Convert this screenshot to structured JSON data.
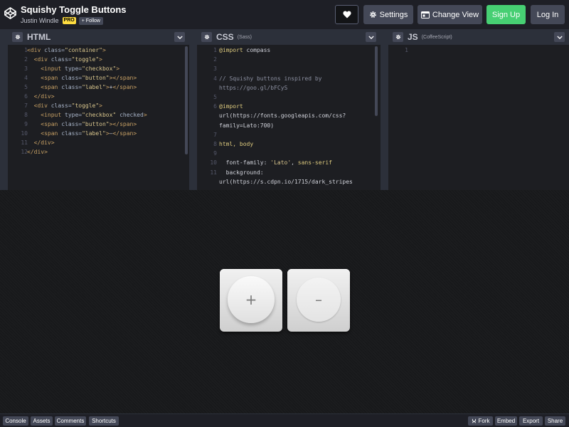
{
  "header": {
    "title": "Squishy Toggle Buttons",
    "author": "Justin Windle",
    "pro_badge": "PRO",
    "follow_label": "+ Follow",
    "settings_label": "Settings",
    "change_view_label": "Change View",
    "signup_label": "Sign Up",
    "login_label": "Log In"
  },
  "editors": {
    "html": {
      "title": "HTML",
      "lines": [
        {
          "n": "1",
          "html": "<span class=\"t\">&lt;div</span> <span class=\"a\">class=</span><span class=\"s\">\"container\"</span><span class=\"t\">&gt;</span>"
        },
        {
          "n": "2",
          "html": "  <span class=\"t\">&lt;div</span> <span class=\"a\">class=</span><span class=\"s\">\"toggle\"</span><span class=\"t\">&gt;</span>"
        },
        {
          "n": "3",
          "html": "    <span class=\"t\">&lt;input</span> <span class=\"a\">type=</span><span class=\"s\">\"checkbox\"</span><span class=\"t\">&gt;</span>"
        },
        {
          "n": "4",
          "html": "    <span class=\"t\">&lt;span</span> <span class=\"a\">class=</span><span class=\"s\">\"button\"</span><span class=\"t\">&gt;&lt;/span&gt;</span>"
        },
        {
          "n": "5",
          "html": "    <span class=\"t\">&lt;span</span> <span class=\"a\">class=</span><span class=\"s\">\"label\"</span><span class=\"t\">&gt;</span>+<span class=\"t\">&lt;/span&gt;</span>"
        },
        {
          "n": "6",
          "html": "  <span class=\"t\">&lt;/div&gt;</span>"
        },
        {
          "n": "7",
          "html": "  <span class=\"t\">&lt;div</span> <span class=\"a\">class=</span><span class=\"s\">\"toggle\"</span><span class=\"t\">&gt;</span>"
        },
        {
          "n": "8",
          "html": "    <span class=\"t\">&lt;input</span> <span class=\"a\">type=</span><span class=\"s\">\"checkbox\"</span> <span class=\"a\">checked</span><span class=\"t\">&gt;</span>"
        },
        {
          "n": "9",
          "html": "    <span class=\"t\">&lt;span</span> <span class=\"a\">class=</span><span class=\"s\">\"button\"</span><span class=\"t\">&gt;&lt;/span&gt;</span>"
        },
        {
          "n": "10",
          "html": "    <span class=\"t\">&lt;span</span> <span class=\"a\">class=</span><span class=\"s\">\"label\"</span><span class=\"t\">&gt;</span>–<span class=\"t\">&lt;/span&gt;</span>"
        },
        {
          "n": "11",
          "html": "  <span class=\"t\">&lt;/div&gt;</span>"
        },
        {
          "n": "12",
          "html": "<span class=\"t\">&lt;/div&gt;</span>"
        }
      ]
    },
    "css": {
      "title": "CSS",
      "preprocessor": "(Sass)",
      "lines": [
        {
          "n": "1",
          "html": "<span class=\"k\">@import</span> compass"
        },
        {
          "n": "2",
          "html": ""
        },
        {
          "n": "3",
          "html": ""
        },
        {
          "n": "4",
          "html": "<span class=\"c\">// Squishy buttons inspired by</span>"
        },
        {
          "n": "",
          "html": "<span class=\"c\">https://goo.gl/bFCyS</span>"
        },
        {
          "n": "5",
          "html": ""
        },
        {
          "n": "6",
          "html": "<span class=\"k\">@import</span>"
        },
        {
          "n": "",
          "html": "url(https://fonts.googleapis.com/css?"
        },
        {
          "n": "",
          "html": "family=Lato:700)"
        },
        {
          "n": "7",
          "html": ""
        },
        {
          "n": "8",
          "html": "<span class=\"k\">html, body</span>"
        },
        {
          "n": "9",
          "html": ""
        },
        {
          "n": "10",
          "html": "  font-family: <span class=\"s\">'Lato'</span>, <span class=\"k\">sans-serif</span>"
        },
        {
          "n": "11",
          "html": "  background:"
        },
        {
          "n": "",
          "html": "url(https://s.cdpn.io/1715/dark_stripes"
        }
      ]
    },
    "js": {
      "title": "JS",
      "preprocessor": "(CoffeeScript)",
      "lines": [
        {
          "n": "1",
          "html": ""
        }
      ]
    }
  },
  "preview": {
    "toggles": [
      {
        "label": "+",
        "checked": false
      },
      {
        "label": "–",
        "checked": true
      }
    ]
  },
  "footer": {
    "left": [
      "Console",
      "Assets",
      "Comments",
      "Shortcuts"
    ],
    "fork_label": "Fork",
    "embed_label": "Embed",
    "export_label": "Export",
    "share_label": "Share"
  }
}
